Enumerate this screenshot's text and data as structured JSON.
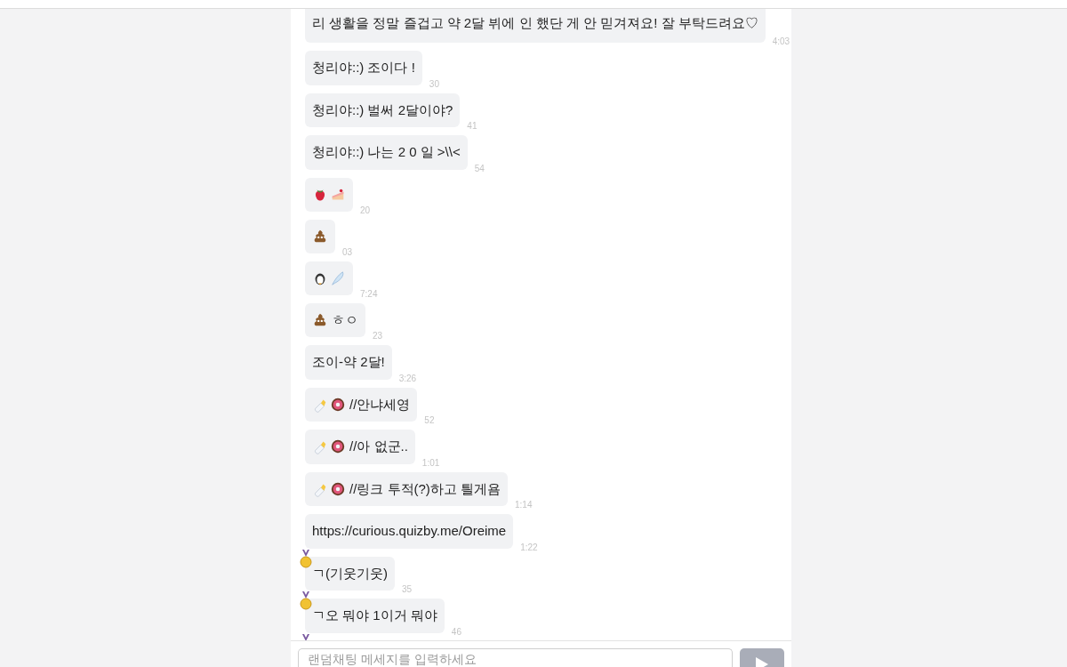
{
  "messages": [
    {
      "kind": "text",
      "text": "리 생활을 정말 즐겁고 약 2달 뷔에 인 했단 게 안 믿겨져요! 잘 부탁드려요♡",
      "time": "4:03",
      "badge": false
    },
    {
      "kind": "text",
      "text": "청리야::) 조이다 !",
      "time": "30",
      "badge": false
    },
    {
      "kind": "text",
      "text": "청리야::) 벌써 2달이야?",
      "time": "41",
      "badge": false
    },
    {
      "kind": "text",
      "text": "청리야::) 나는 2 0 일 >\\\\<",
      "time": "54",
      "badge": false
    },
    {
      "kind": "strawberry-cake",
      "time": "20",
      "badge": false
    },
    {
      "kind": "poop",
      "time": "03",
      "badge": false
    },
    {
      "kind": "penguin-feather",
      "time": "7:24",
      "badge": false
    },
    {
      "kind": "poop",
      "text": "ㅎㅇ",
      "time": "23",
      "badge": false
    },
    {
      "kind": "text",
      "text": "조이-약 2달!",
      "time": "3:26",
      "badge": false
    },
    {
      "kind": "bottle-donut",
      "text": "//안냐세영",
      "time": "52",
      "badge": false
    },
    {
      "kind": "bottle-donut",
      "text": "//아 없군..",
      "time": "1:01",
      "badge": false
    },
    {
      "kind": "bottle-donut",
      "text": "//링크 투적(?)하고 틜게욤",
      "time": "1:14",
      "badge": false
    },
    {
      "kind": "text",
      "text": "https://curious.quizby.me/Oreime",
      "time": "1:22",
      "badge": false
    },
    {
      "kind": "text",
      "text": "ㄱ(기웃기웃)",
      "time": "35",
      "badge": true
    },
    {
      "kind": "text",
      "text": "ㄱ오 뭐야 1이거 뭐야",
      "time": "46",
      "badge": true
    },
    {
      "kind": "text",
      "badge": true
    }
  ],
  "input": {
    "placeholder": "랜덤채팅 메세지를 입력하세요"
  }
}
